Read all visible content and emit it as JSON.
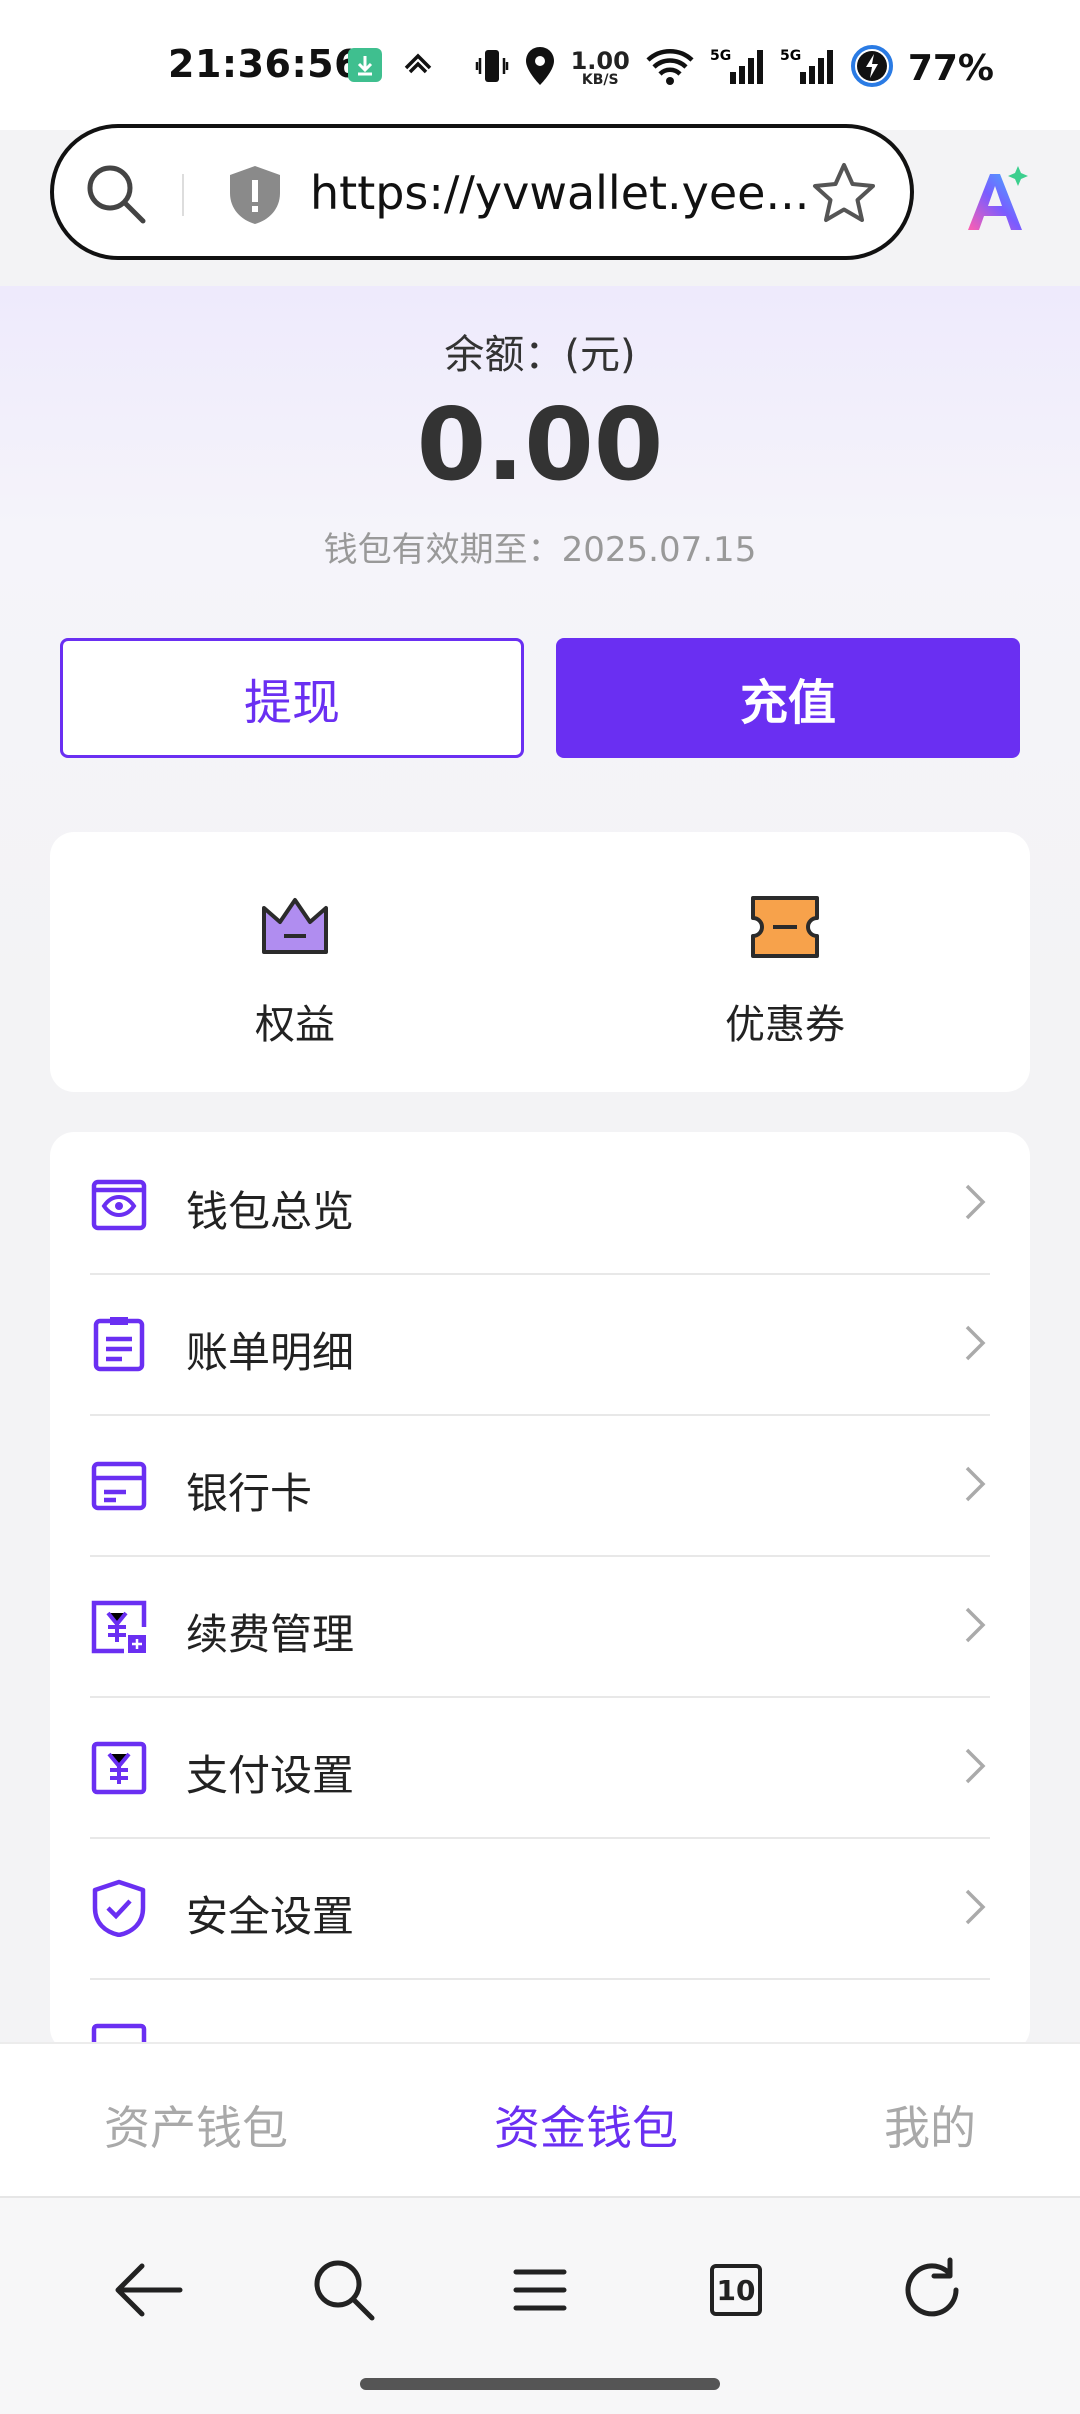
{
  "status_bar": {
    "time": "21:36:56",
    "net_speed_value": "1.00",
    "net_speed_unit": "KB/S",
    "battery": "77%"
  },
  "browser": {
    "url": "https://yvwallet.yee...",
    "icons": [
      "search-icon",
      "shield-icon",
      "star-icon",
      "ai-assistant-icon"
    ]
  },
  "wallet": {
    "balance_label": "余额：(元)",
    "balance_value": "0.00",
    "validity": "钱包有效期至：2025.07.15",
    "withdraw_label": "提现",
    "recharge_label": "充值"
  },
  "quick_actions": [
    {
      "label": "权益",
      "icon": "crown-icon"
    },
    {
      "label": "优惠券",
      "icon": "coupon-icon"
    }
  ],
  "menu": [
    {
      "label": "钱包总览",
      "icon": "wallet-overview-icon"
    },
    {
      "label": "账单明细",
      "icon": "bill-icon"
    },
    {
      "label": "银行卡",
      "icon": "bank-card-icon"
    },
    {
      "label": "续费管理",
      "icon": "renewal-icon"
    },
    {
      "label": "支付设置",
      "icon": "payment-settings-icon"
    },
    {
      "label": "安全设置",
      "icon": "security-icon"
    }
  ],
  "tabs": [
    {
      "label": "资产钱包",
      "active": false
    },
    {
      "label": "资金钱包",
      "active": true
    },
    {
      "label": "我的",
      "active": false
    }
  ],
  "browser_nav": {
    "tab_count": "10",
    "icons": [
      "back-icon",
      "search-icon",
      "menu-icon",
      "tabs-icon",
      "refresh-icon"
    ]
  },
  "colors": {
    "accent": "#6a2ff2",
    "crown": "#b08df0",
    "coupon": "#f7a24b"
  }
}
